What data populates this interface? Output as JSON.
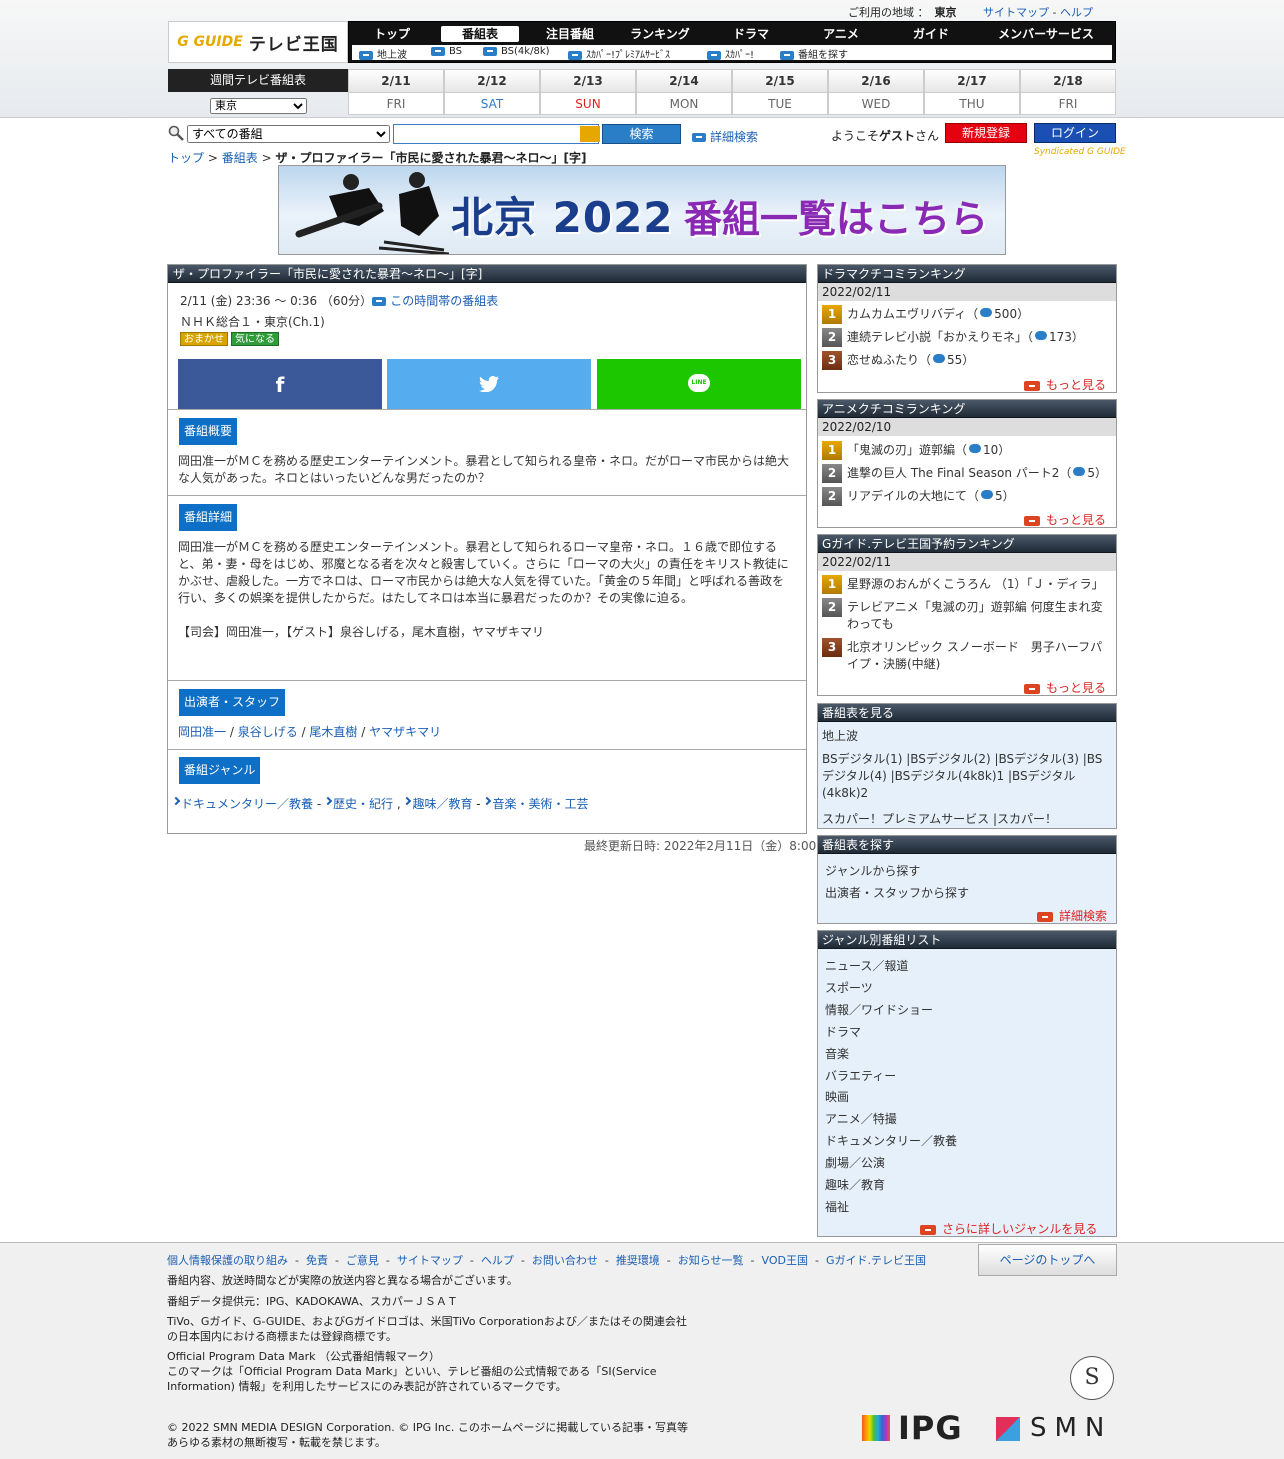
{
  "header": {
    "region_label": "ご利用の地域 ：",
    "region_value": "東京",
    "sitemap": "サイトマップ",
    "sep": "-",
    "help": "ヘルプ",
    "logo_mark": "G GUIDE",
    "logo_text": "テレビ王国"
  },
  "nav": [
    "トップ",
    "番組表",
    "注目番組",
    "ランキング",
    "ドラマ",
    "アニメ",
    "ガイド",
    "メンバーサービス"
  ],
  "subnav": [
    "地上波",
    "BS",
    "BS(4k/8k)",
    "ｽｶﾊﾟｰ!ﾌﾟﾚﾐｱﾑｻｰﾋﾞｽ",
    "ｽｶﾊﾟｰ!",
    "番組を探す"
  ],
  "weekly": {
    "title": "週間テレビ番組表",
    "pref": "東京",
    "days": [
      {
        "d": "2/11",
        "w": "FRI"
      },
      {
        "d": "2/12",
        "w": "SAT"
      },
      {
        "d": "2/13",
        "w": "SUN"
      },
      {
        "d": "2/14",
        "w": "MON"
      },
      {
        "d": "2/15",
        "w": "TUE"
      },
      {
        "d": "2/16",
        "w": "WED"
      },
      {
        "d": "2/17",
        "w": "THU"
      },
      {
        "d": "2/18",
        "w": "FRI"
      }
    ]
  },
  "search": {
    "genre": "すべての番組",
    "button": "検索",
    "detail": "詳細検索",
    "welcome_pre": "ようこそ",
    "welcome_name": "ゲスト",
    "welcome_post": "さん",
    "register": "新規登録",
    "login": "ログイン"
  },
  "breadcrumb": {
    "top": "トップ",
    "schedule": "番組表",
    "sep": ">",
    "current": "ザ・プロファイラー「市民に愛された暴君～ネロ～」[字]",
    "syndicated": "Syndicated G GUIDE"
  },
  "banner": {
    "t1": "北京 2022",
    "t2": "番組一覧はこちら"
  },
  "program": {
    "title": "ザ・プロファイラー「市民に愛された暴君～ネロ～」[字]",
    "airtime": "2/11 (金) 23:36 ～ 0:36 （60分）",
    "timeslot_link": "この時間帯の番組表",
    "channel": "ＮＨＫ総合１・東京(Ch.1)",
    "tag1": "おまかせ",
    "tag2": "気になる",
    "sns_fb": "f",
    "sns_tw": "🐦",
    "sns_line": "LINE",
    "overview_h": "番組概要",
    "overview": "岡田准一がＭＣを務める歴史エンターテインメント。暴君として知られる皇帝・ネロ。だがローマ市民からは絶大な人気があった。ネロとはいったいどんな男だったのか？",
    "detail_h": "番組詳細",
    "detail": "岡田准一がＭＣを務める歴史エンターテインメント。暴君として知られるローマ皇帝・ネロ。１６歳で即位すると、弟・妻・母をはじめ、邪魔となる者を次々と殺害していく。さらに「ローマの大火」の責任をキリスト教徒にかぶせ、虐殺した。一方でネロは、ローマ市民からは絶大な人気を得ていた。「黄金の５年間」と呼ばれる善政を行い、多くの娯楽を提供したからだ。はたしてネロは本当に暴君だったのか？その実像に迫る。",
    "detail2": "【司会】岡田准一，【ゲスト】泉谷しげる，尾木直樹，ヤマザキマリ",
    "cast_h": "出演者・スタッフ",
    "cast": [
      "岡田准一",
      "泉谷しげる",
      "尾木直樹",
      "ヤマザキマリ"
    ],
    "cast_sep": " / ",
    "genre_h": "番組ジャンル",
    "genres": [
      "ドキュメンタリー／教養",
      "歴史・紀行",
      "趣味／教育",
      "音楽・美術・工芸"
    ],
    "genre_sep1": " - ",
    "genre_sep2": " , ",
    "updated": "最終更新日時: 2022年2月11日（金）8:00"
  },
  "drama_rank": {
    "title": "ドラマクチコミランキング",
    "date": "2022/02/11",
    "items": [
      {
        "n": "1",
        "t": "カムカムエヴリバディ（",
        "c": "500）"
      },
      {
        "n": "2",
        "t": "連続テレビ小説「おかえりモネ」（",
        "c": "173）"
      },
      {
        "n": "3",
        "t": "恋せぬふたり（",
        "c": "55）"
      }
    ],
    "more": "もっと見る"
  },
  "anime_rank": {
    "title": "アニメクチコミランキング",
    "date": "2022/02/10",
    "items": [
      {
        "n": "1",
        "t": "「鬼滅の刃」遊郭編（",
        "c": "10）"
      },
      {
        "n": "2",
        "t": "進撃の巨人 The Final Season パート2（",
        "c": "5）"
      },
      {
        "n": "2",
        "t": "リアデイルの大地にて（",
        "c": "5）"
      }
    ],
    "more": "もっと見る"
  },
  "reserve_rank": {
    "title": "Gガイド.テレビ王国予約ランキング",
    "date": "2022/02/11",
    "items": [
      {
        "n": "1",
        "t": "星野源のおんがくこうろん （1）「Ｊ・ディラ」"
      },
      {
        "n": "2",
        "t": "テレビアニメ「鬼滅の刃」遊郭編 何度生まれ変わっても"
      },
      {
        "n": "3",
        "t": "北京オリンピック スノーボード　男子ハーフパイプ・決勝(中継)"
      }
    ],
    "more": "もっと見る"
  },
  "view_sched": {
    "title": "番組表を見る",
    "terr": "地上波",
    "bs": "BSデジタル(1) |BSデジタル(2) |BSデジタル(3) |BSデジタル(4) |BSデジタル(4k8k)1 |BSデジタル(4k8k)2",
    "cs": "スカパー！プレミアムサービス |スカパー！"
  },
  "find_sched": {
    "title": "番組表を探す",
    "items": [
      "ジャンルから探す",
      "出演者・スタッフから探す"
    ],
    "more": "詳細検索"
  },
  "genre_list": {
    "title": "ジャンル別番組リスト",
    "items": [
      "ニュース／報道",
      "スポーツ",
      "情報／ワイドショー",
      "ドラマ",
      "音楽",
      "バラエティー",
      "映画",
      "アニメ／特撮",
      "ドキュメンタリー／教養",
      "劇場／公演",
      "趣味／教育",
      "福祉"
    ],
    "more": "さらに詳しいジャンルを見る"
  },
  "footer": {
    "links": [
      "個人情報保護の取り組み",
      "免責",
      "ご意見",
      "サイトマップ",
      "ヘルプ",
      "お問い合わせ",
      "推奨環境",
      "お知らせ一覧",
      "VOD王国",
      "Gガイド.テレビ王国"
    ],
    "pagetop": "ページのトップへ",
    "note1": "番組内容、放送時間などが実際の放送内容と異なる場合がございます。",
    "note2": "番組データ提供元：IPG、KADOKAWA、スカパーＪＳＡＴ",
    "note3": "TiVo、Gガイド、G-GUIDE、およびGガイドロゴは、米国TiVo Corporationおよび／またはその関連会社の日本国内における商標または登録商標です。",
    "note4a": "Official Program Data Mark （公式番組情報マーク）",
    "note4b": "このマークは「Official Program Data Mark」といい、テレビ番組の公式情報である「SI(Service Information) 情報」を利用したサービスにのみ表記が許されているマークです。",
    "copyright": "© 2022 SMN MEDIA DESIGN Corporation. © IPG Inc. このホームページに掲載している記事・写真等 あらゆる素材の無断複写・転載を禁じます。",
    "seal": "S",
    "ipg": "IPG",
    "smn": "SMN"
  }
}
